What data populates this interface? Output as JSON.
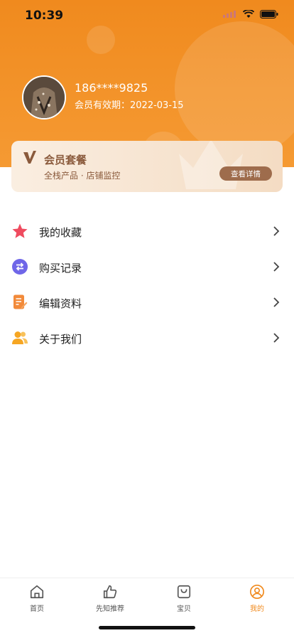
{
  "status_bar": {
    "time": "10:39"
  },
  "profile": {
    "phone": "186****9825",
    "membership_expiry": "会员有效期：2022-03-15"
  },
  "vip": {
    "title": "会员套餐",
    "subtitle": "全栈产品 · 店铺监控",
    "button": "查看详情",
    "logo_text": "VIP"
  },
  "menu": [
    {
      "label": "我的收藏",
      "icon": "star-icon"
    },
    {
      "label": "购买记录",
      "icon": "exchange-icon"
    },
    {
      "label": "编辑资料",
      "icon": "edit-document-icon"
    },
    {
      "label": "关于我们",
      "icon": "people-icon"
    }
  ],
  "tabs": [
    {
      "label": "首页",
      "icon": "home-icon",
      "active": false
    },
    {
      "label": "先知推荐",
      "icon": "thumbs-up-icon",
      "active": false
    },
    {
      "label": "宝贝",
      "icon": "shopping-bag-icon",
      "active": false
    },
    {
      "label": "我的",
      "icon": "user-icon",
      "active": true
    }
  ],
  "colors": {
    "accent": "#f08a1e",
    "vip_brown": "#9e6c4c",
    "star_red": "#ef4b5f",
    "exchange_purple": "#6f66e8",
    "edit_orange": "#f28a3a",
    "people_orange": "#f6a623"
  }
}
